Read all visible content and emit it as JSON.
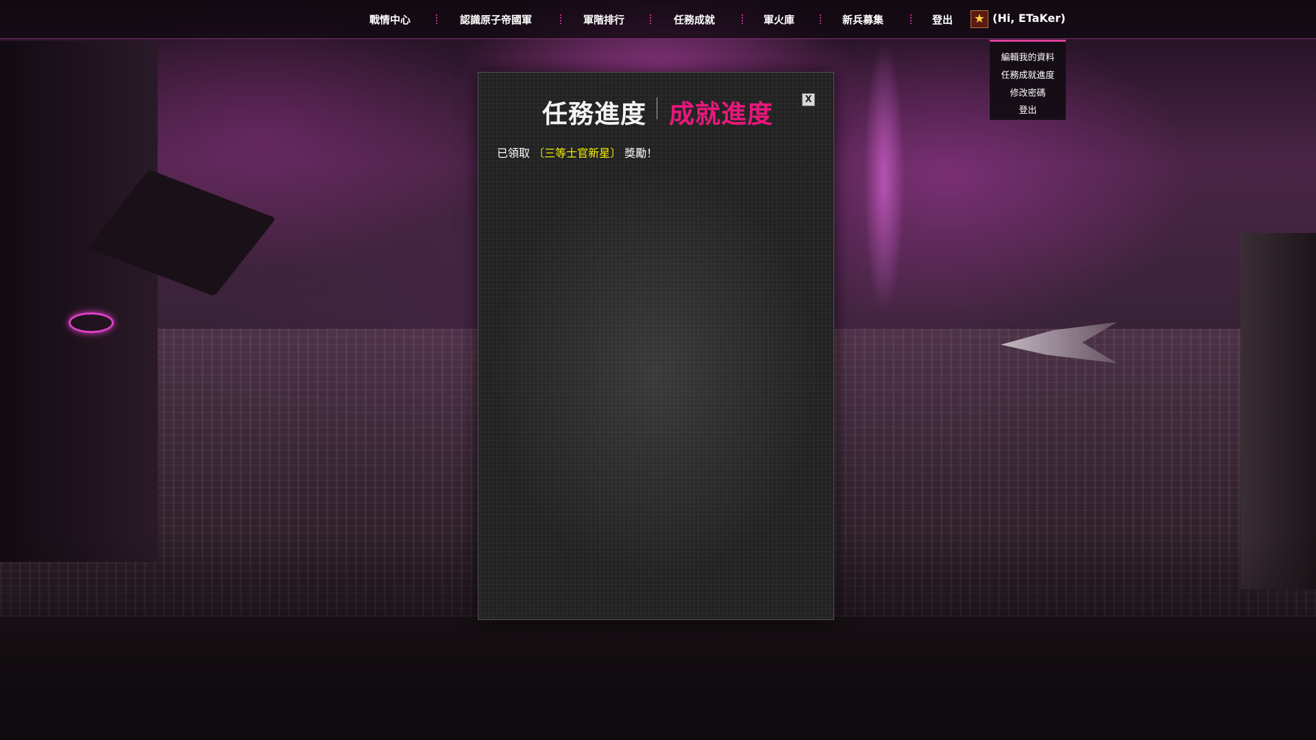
{
  "nav": {
    "items": [
      "戰情中心",
      "認識原子帝國軍",
      "軍階排行",
      "任務成就",
      "軍火庫",
      "新兵募集",
      "登出"
    ],
    "greeting": "(Hi, ETaKer)",
    "avatar_icon": "rank-star-icon"
  },
  "user_menu": {
    "items": [
      "編輯我的資料",
      "任務成就進度",
      "修改密碼",
      "登出"
    ]
  },
  "modal": {
    "tab_mission": "任務進度",
    "tab_achievement": "成就進度",
    "close_label": "X",
    "message_prefix": "已領取",
    "message_highlight": "〔三等士官新星〕",
    "message_suffix": "獎勵！"
  },
  "colors": {
    "accent_pink": "#e8187a",
    "highlight_yellow": "#f6f000",
    "nav_separator": "#c03090"
  }
}
